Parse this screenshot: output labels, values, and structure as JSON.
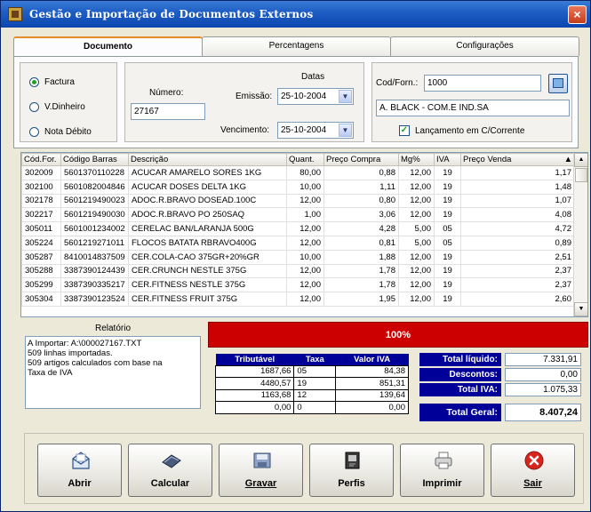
{
  "window": {
    "title": "Gestão e Importação de Documentos Externos",
    "close": "×"
  },
  "tabs": [
    {
      "label": "Documento"
    },
    {
      "label": "Percentagens"
    },
    {
      "label": "Configurações"
    }
  ],
  "doc_type": {
    "options": [
      "Factura",
      "V.Dinheiro",
      "Nota Débito"
    ],
    "selected": "Factura"
  },
  "numero": {
    "label": "Número:",
    "value": "27167"
  },
  "datas": {
    "title": "Datas",
    "emissao_label": "Emissão:",
    "emissao_value": "25-10-2004",
    "vencimento_label": "Vencimento:",
    "vencimento_value": "25-10-2004"
  },
  "fornecedor": {
    "label": "Cod/Forn.:",
    "code": "1000",
    "name": "A. BLACK - COM.E IND.SA",
    "checkbox_label": "Lançamento em C/Corrente",
    "checked": true
  },
  "grid": {
    "headers": [
      "Cód.For.",
      "Código Barras",
      "Descrição",
      "Quant.",
      "Preço Compra",
      "Mg%",
      "IVA",
      "Preço Venda"
    ],
    "rows": [
      [
        "302009",
        "5601370110228",
        "ACUCAR AMARELO SORES 1KG",
        "80,00",
        "0,88",
        "12,00",
        "19",
        "1,17"
      ],
      [
        "302100",
        "5601082004846",
        "ACUCAR DOSES DELTA 1KG",
        "10,00",
        "1,11",
        "12,00",
        "19",
        "1,48"
      ],
      [
        "302178",
        "5601219490023",
        "ADOC.R.BRAVO DOSEAD.100C",
        "12,00",
        "0,80",
        "12,00",
        "19",
        "1,07"
      ],
      [
        "302217",
        "5601219490030",
        "ADOC.R.BRAVO PO 250SAQ",
        "1,00",
        "3,06",
        "12,00",
        "19",
        "4,08"
      ],
      [
        "305011",
        "5601001234002",
        "CERELAC BAN/LARANJA 500G",
        "12,00",
        "4,28",
        "5,00",
        "05",
        "4,72"
      ],
      [
        "305224",
        "5601219271011",
        "FLOCOS BATATA RBRAVO400G",
        "12,00",
        "0,81",
        "5,00",
        "05",
        "0,89"
      ],
      [
        "305287",
        "8410014837509",
        "CER.COLA-CAO 375GR+20%GR",
        "10,00",
        "1,88",
        "12,00",
        "19",
        "2,51"
      ],
      [
        "305288",
        "3387390124439",
        "CER.CRUNCH NESTLE 375G",
        "12,00",
        "1,78",
        "12,00",
        "19",
        "2,37"
      ],
      [
        "305299",
        "3387390335217",
        "CER.FITNESS NESTLE 375G",
        "12,00",
        "1,78",
        "12,00",
        "19",
        "2,37"
      ],
      [
        "305304",
        "3387390123524",
        "CER.FITNESS FRUIT 375G",
        "12,00",
        "1,95",
        "12,00",
        "19",
        "2,60"
      ]
    ]
  },
  "relatorio": {
    "title": "Relatório",
    "lines": [
      "A Importar: A:\\000027167.TXT",
      "509 linhas importadas.",
      "509 artigos calculados com base na",
      "Taxa de IVA"
    ]
  },
  "progress": {
    "text": "100%",
    "value": 1.0,
    "color": "#cc0000"
  },
  "iva_table": {
    "headers": [
      "Tributável",
      "Taxa",
      "Valor IVA"
    ],
    "rows": [
      [
        "1687,66",
        "05",
        "84,38"
      ],
      [
        "4480,57",
        "19",
        "851,31"
      ],
      [
        "1163,68",
        "12",
        "139,64"
      ],
      [
        "0,00",
        "0",
        "0,00"
      ]
    ]
  },
  "totals": {
    "liquido_label": "Total líquido:",
    "liquido_value": "7.331,91",
    "descontos_label": "Descontos:",
    "descontos_value": "0,00",
    "iva_label": "Total IVA:",
    "iva_value": "1.075,33",
    "geral_label": "Total Geral:",
    "geral_value": "8.407,24"
  },
  "buttons": [
    {
      "label": "Abrir",
      "icon": "open-envelope-icon"
    },
    {
      "label": "Calcular",
      "icon": "calculator-icon"
    },
    {
      "label": "Gravar",
      "icon": "save-icon"
    },
    {
      "label": "Perfis",
      "icon": "profiles-icon"
    },
    {
      "label": "Imprimir",
      "icon": "printer-icon"
    },
    {
      "label": "Sair",
      "icon": "exit-icon"
    }
  ],
  "colors": {
    "title_blue": "#0b46b0",
    "header_navy": "#000099",
    "progress_red": "#cc0000"
  }
}
